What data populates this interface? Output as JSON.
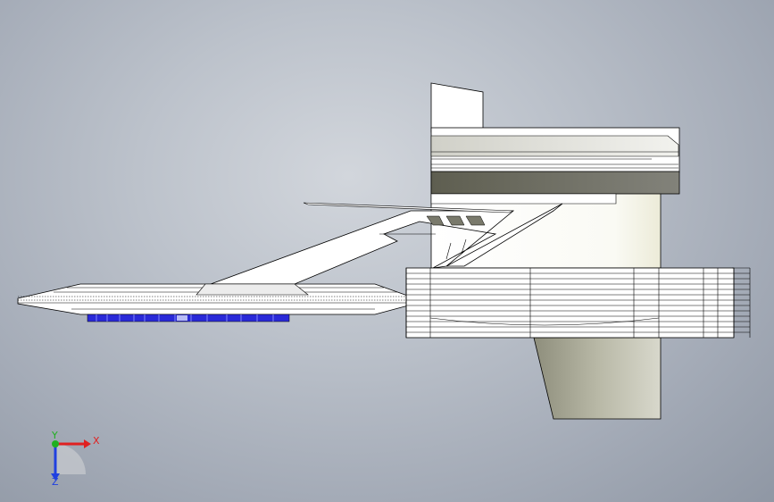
{
  "viewport": {
    "background_top": "#d2d6dc",
    "background_bottom": "#8f97a4"
  },
  "model": {
    "part_fill": "#ffffff",
    "edge_color": "#000000",
    "shaded_face": "#dcdcd6",
    "dark_face": "#6e6e5e",
    "lower_block": "#a8a896",
    "blue_segment": "#2a2ad8"
  },
  "triad": {
    "x_label": "X",
    "y_label": "Y",
    "z_label": "Z",
    "x_color": "#e02020",
    "y_color": "#20b020",
    "z_color": "#2040e0"
  }
}
